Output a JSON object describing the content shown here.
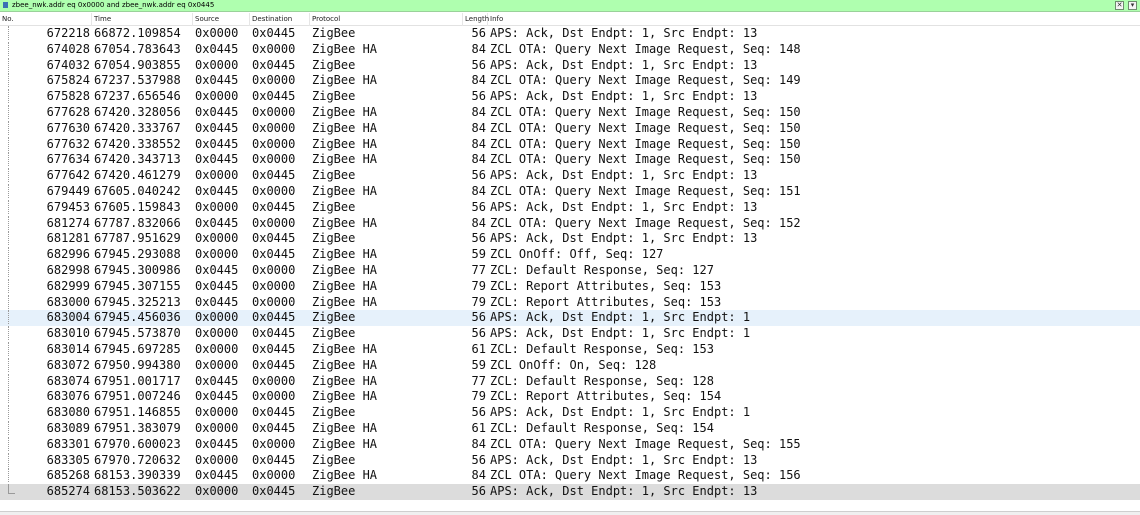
{
  "filter": {
    "expression": "zbee_nwk.addr eq 0x0000 and zbee_nwk.addr eq 0x0445",
    "clear_icon": "close-icon",
    "dropdown_icon": "chevron-down-icon"
  },
  "columns": {
    "no": "No.",
    "time": "Time",
    "source": "Source",
    "destination": "Destination",
    "protocol": "Protocol",
    "length": "Length",
    "info": "Info"
  },
  "packets": [
    {
      "no": "672218",
      "time": "66872.109854",
      "source": "0x0000",
      "destination": "0x0445",
      "protocol": "ZigBee",
      "length": "56",
      "info": "APS: Ack, Dst Endpt: 1, Src Endpt: 13"
    },
    {
      "no": "674028",
      "time": "67054.783643",
      "source": "0x0445",
      "destination": "0x0000",
      "protocol": "ZigBee HA",
      "length": "84",
      "info": "ZCL OTA: Query Next Image Request, Seq: 148"
    },
    {
      "no": "674032",
      "time": "67054.903855",
      "source": "0x0000",
      "destination": "0x0445",
      "protocol": "ZigBee",
      "length": "56",
      "info": "APS: Ack, Dst Endpt: 1, Src Endpt: 13"
    },
    {
      "no": "675824",
      "time": "67237.537988",
      "source": "0x0445",
      "destination": "0x0000",
      "protocol": "ZigBee HA",
      "length": "84",
      "info": "ZCL OTA: Query Next Image Request, Seq: 149"
    },
    {
      "no": "675828",
      "time": "67237.656546",
      "source": "0x0000",
      "destination": "0x0445",
      "protocol": "ZigBee",
      "length": "56",
      "info": "APS: Ack, Dst Endpt: 1, Src Endpt: 13"
    },
    {
      "no": "677628",
      "time": "67420.328056",
      "source": "0x0445",
      "destination": "0x0000",
      "protocol": "ZigBee HA",
      "length": "84",
      "info": "ZCL OTA: Query Next Image Request, Seq: 150"
    },
    {
      "no": "677630",
      "time": "67420.333767",
      "source": "0x0445",
      "destination": "0x0000",
      "protocol": "ZigBee HA",
      "length": "84",
      "info": "ZCL OTA: Query Next Image Request, Seq: 150"
    },
    {
      "no": "677632",
      "time": "67420.338552",
      "source": "0x0445",
      "destination": "0x0000",
      "protocol": "ZigBee HA",
      "length": "84",
      "info": "ZCL OTA: Query Next Image Request, Seq: 150"
    },
    {
      "no": "677634",
      "time": "67420.343713",
      "source": "0x0445",
      "destination": "0x0000",
      "protocol": "ZigBee HA",
      "length": "84",
      "info": "ZCL OTA: Query Next Image Request, Seq: 150"
    },
    {
      "no": "677642",
      "time": "67420.461279",
      "source": "0x0000",
      "destination": "0x0445",
      "protocol": "ZigBee",
      "length": "56",
      "info": "APS: Ack, Dst Endpt: 1, Src Endpt: 13"
    },
    {
      "no": "679449",
      "time": "67605.040242",
      "source": "0x0445",
      "destination": "0x0000",
      "protocol": "ZigBee HA",
      "length": "84",
      "info": "ZCL OTA: Query Next Image Request, Seq: 151"
    },
    {
      "no": "679453",
      "time": "67605.159843",
      "source": "0x0000",
      "destination": "0x0445",
      "protocol": "ZigBee",
      "length": "56",
      "info": "APS: Ack, Dst Endpt: 1, Src Endpt: 13"
    },
    {
      "no": "681274",
      "time": "67787.832066",
      "source": "0x0445",
      "destination": "0x0000",
      "protocol": "ZigBee HA",
      "length": "84",
      "info": "ZCL OTA: Query Next Image Request, Seq: 152"
    },
    {
      "no": "681281",
      "time": "67787.951629",
      "source": "0x0000",
      "destination": "0x0445",
      "protocol": "ZigBee",
      "length": "56",
      "info": "APS: Ack, Dst Endpt: 1, Src Endpt: 13"
    },
    {
      "no": "682996",
      "time": "67945.293088",
      "source": "0x0000",
      "destination": "0x0445",
      "protocol": "ZigBee HA",
      "length": "59",
      "info": "ZCL OnOff: Off, Seq: 127"
    },
    {
      "no": "682998",
      "time": "67945.300986",
      "source": "0x0445",
      "destination": "0x0000",
      "protocol": "ZigBee HA",
      "length": "77",
      "info": "ZCL: Default Response, Seq: 127"
    },
    {
      "no": "682999",
      "time": "67945.307155",
      "source": "0x0445",
      "destination": "0x0000",
      "protocol": "ZigBee HA",
      "length": "79",
      "info": "ZCL: Report Attributes, Seq: 153"
    },
    {
      "no": "683000",
      "time": "67945.325213",
      "source": "0x0445",
      "destination": "0x0000",
      "protocol": "ZigBee HA",
      "length": "79",
      "info": "ZCL: Report Attributes, Seq: 153"
    },
    {
      "no": "683004",
      "time": "67945.456036",
      "source": "0x0000",
      "destination": "0x0445",
      "protocol": "ZigBee",
      "length": "56",
      "info": "APS: Ack, Dst Endpt: 1, Src Endpt: 1"
    },
    {
      "no": "683010",
      "time": "67945.573870",
      "source": "0x0000",
      "destination": "0x0445",
      "protocol": "ZigBee",
      "length": "56",
      "info": "APS: Ack, Dst Endpt: 1, Src Endpt: 1"
    },
    {
      "no": "683014",
      "time": "67945.697285",
      "source": "0x0000",
      "destination": "0x0445",
      "protocol": "ZigBee HA",
      "length": "61",
      "info": "ZCL: Default Response, Seq: 153"
    },
    {
      "no": "683072",
      "time": "67950.994380",
      "source": "0x0000",
      "destination": "0x0445",
      "protocol": "ZigBee HA",
      "length": "59",
      "info": "ZCL OnOff: On, Seq: 128"
    },
    {
      "no": "683074",
      "time": "67951.001717",
      "source": "0x0445",
      "destination": "0x0000",
      "protocol": "ZigBee HA",
      "length": "77",
      "info": "ZCL: Default Response, Seq: 128"
    },
    {
      "no": "683076",
      "time": "67951.007246",
      "source": "0x0445",
      "destination": "0x0000",
      "protocol": "ZigBee HA",
      "length": "79",
      "info": "ZCL: Report Attributes, Seq: 154"
    },
    {
      "no": "683080",
      "time": "67951.146855",
      "source": "0x0000",
      "destination": "0x0445",
      "protocol": "ZigBee",
      "length": "56",
      "info": "APS: Ack, Dst Endpt: 1, Src Endpt: 1"
    },
    {
      "no": "683089",
      "time": "67951.383079",
      "source": "0x0000",
      "destination": "0x0445",
      "protocol": "ZigBee HA",
      "length": "61",
      "info": "ZCL: Default Response, Seq: 154"
    },
    {
      "no": "683301",
      "time": "67970.600023",
      "source": "0x0445",
      "destination": "0x0000",
      "protocol": "ZigBee HA",
      "length": "84",
      "info": "ZCL OTA: Query Next Image Request, Seq: 155"
    },
    {
      "no": "683305",
      "time": "67970.720632",
      "source": "0x0000",
      "destination": "0x0445",
      "protocol": "ZigBee",
      "length": "56",
      "info": "APS: Ack, Dst Endpt: 1, Src Endpt: 13"
    },
    {
      "no": "685268",
      "time": "68153.390339",
      "source": "0x0445",
      "destination": "0x0000",
      "protocol": "ZigBee HA",
      "length": "84",
      "info": "ZCL OTA: Query Next Image Request, Seq: 156"
    },
    {
      "no": "685274",
      "time": "68153.503622",
      "source": "0x0000",
      "destination": "0x0445",
      "protocol": "ZigBee",
      "length": "56",
      "info": "APS: Ack, Dst Endpt: 1, Src Endpt: 13"
    }
  ],
  "colors": {
    "filter_valid_bg": "#afffaf",
    "hover_row_bg": "#e6f1fb",
    "selected_row_bg": "#dcdcdc"
  }
}
